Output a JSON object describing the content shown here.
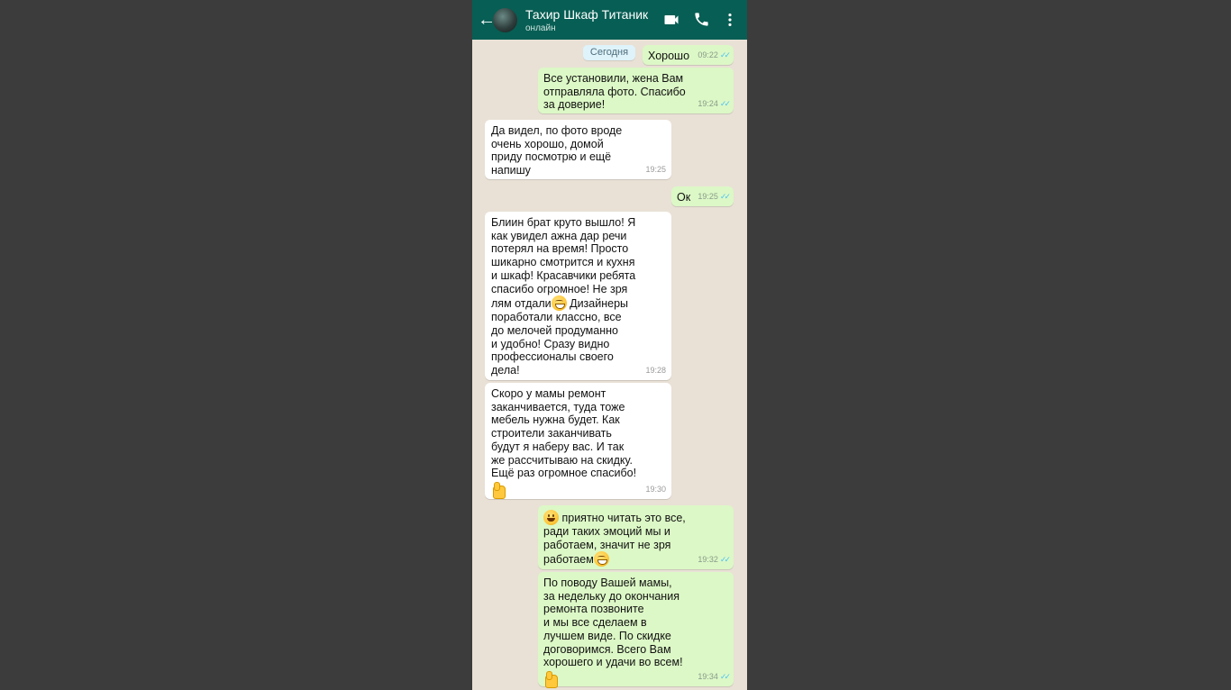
{
  "header": {
    "contact_name": "Тахир Шкаф Титаник",
    "status": "онлайн",
    "back_icon": "arrow-left-icon",
    "video_icon": "video-camera-icon",
    "call_icon": "phone-icon",
    "menu_icon": "more-vert-icon"
  },
  "date_separator": "Сегодня",
  "messages": [
    {
      "dir": "out",
      "text": "Хорошо",
      "time": "09:22",
      "read": true
    },
    {
      "dir": "out",
      "text": "Все установили, жена Вам\nотправляла фото. Спасибо\nза доверие!",
      "time": "19:24",
      "read": true
    },
    {
      "dir": "in",
      "text": "Да видел, по фото вроде\nочень хорошо, домой\nприду посмотрю и ещё\nнапишу",
      "time": "19:25"
    },
    {
      "dir": "out",
      "text": "Ок",
      "time": "19:25",
      "read": true
    },
    {
      "dir": "in",
      "text_a": "Блиин брат круто вышло! Я\nкак увидел ажна дар речи\nпотерял на время! Просто\nшикарно смотрится и кухня\nи шкаф! Красавчики ребята\nспасибо огромное! Не зря\nлям отдали",
      "text_b": " Дизайнеры\nпоработали классно, все\nдо мелочей продуманно\nи удобно! Сразу видно\nпрофессионалы своего\nдела!",
      "time": "19:28"
    },
    {
      "dir": "in",
      "text": "Скоро у мамы ремонт\nзаканчивается, туда тоже\nмебель нужна будет. Как\nстроители заканчивать\nбудут я наберу вас. И так\nже рассчитываю на скидку.\nЕщё раз огромное спасибо!",
      "time": "19:30"
    },
    {
      "dir": "out",
      "text_a": " приятно читать это все,\nради таких эмоций мы и\nработаем, значит не зря\nработаем",
      "time": "19:32",
      "read": true
    },
    {
      "dir": "out",
      "text": "По поводу Вашей мамы,\nза недельку до окончания\nремонта позвоните\nи мы все сделаем в\nлучшем виде. По скидке\nдоговоримся. Всего Вам\nхорошего и удачи во всем!",
      "time": "19:34",
      "read": true
    }
  ],
  "colors": {
    "header_bg": "#075e54",
    "chat_bg": "#e9e1d6",
    "outgoing_bubble": "#dcf8c6",
    "incoming_bubble": "#ffffff",
    "read_ticks": "#4fc3f7"
  }
}
